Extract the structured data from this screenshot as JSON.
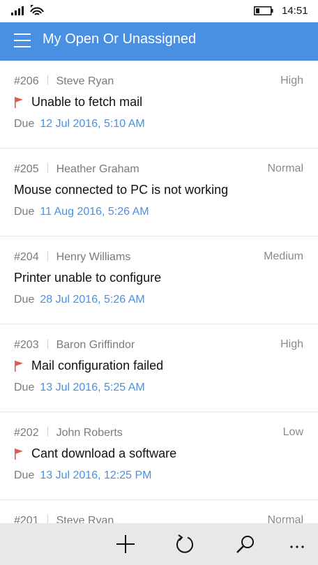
{
  "status_bar": {
    "time": "14:51"
  },
  "header": {
    "title": "My Open Or Unassigned"
  },
  "tickets": [
    {
      "id": "#206",
      "requester": "Steve Ryan",
      "priority": "High",
      "subject": "Unable to fetch mail",
      "flagged": true,
      "due_label": "Due",
      "due_date": "12 Jul 2016, 5:10 AM"
    },
    {
      "id": "#205",
      "requester": "Heather Graham",
      "priority": "Normal",
      "subject": "Mouse connected to PC is not working",
      "flagged": false,
      "due_label": "Due",
      "due_date": "11 Aug 2016, 5:26 AM"
    },
    {
      "id": "#204",
      "requester": "Henry Williams",
      "priority": "Medium",
      "subject": "Printer unable to configure",
      "flagged": false,
      "due_label": "Due",
      "due_date": "28 Jul 2016, 5:26 AM"
    },
    {
      "id": "#203",
      "requester": "Baron Griffindor",
      "priority": "High",
      "subject": "Mail configuration failed",
      "flagged": true,
      "due_label": "Due",
      "due_date": "13 Jul 2016, 5:25 AM"
    },
    {
      "id": "#202",
      "requester": "John Roberts",
      "priority": "Low",
      "subject": "Cant download a software",
      "flagged": true,
      "due_label": "Due",
      "due_date": "13 Jul 2016, 12:25 PM"
    },
    {
      "id": "#201",
      "requester": "Steve Ryan",
      "priority": "Normal",
      "subject": "",
      "flagged": false,
      "due_label": "",
      "due_date": ""
    }
  ],
  "app_bar": {
    "buttons": [
      "add-icon",
      "refresh-icon",
      "search-icon",
      "more-icon"
    ]
  },
  "colors": {
    "accent": "#4a90e2",
    "flag": "#e05a4f",
    "app_bar_bg": "#e8e8e8"
  }
}
